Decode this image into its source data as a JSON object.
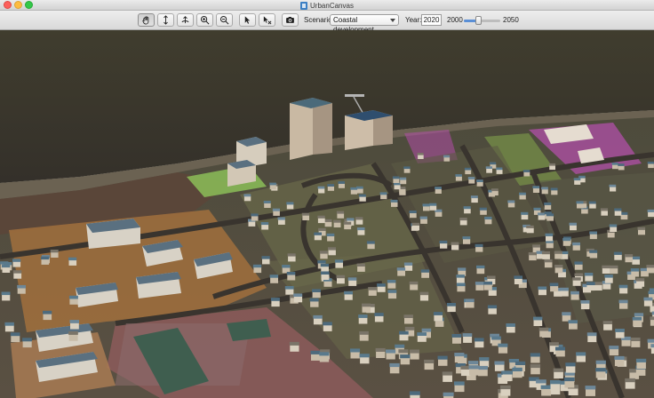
{
  "window": {
    "title": "UrbanCanvas"
  },
  "toolbar": {
    "tools": [
      {
        "name": "pan-tool",
        "icon": "hand-icon",
        "active": true
      },
      {
        "name": "tilt-tool",
        "icon": "vertical-arrows-icon",
        "active": false
      },
      {
        "name": "rotate-tool",
        "icon": "rotate-icon",
        "active": false
      },
      {
        "name": "zoom-in-tool",
        "icon": "zoom-in-icon",
        "active": false
      },
      {
        "name": "zoom-out-tool",
        "icon": "zoom-out-icon",
        "active": false
      },
      {
        "name": "select-tool",
        "icon": "pointer-icon",
        "active": false
      },
      {
        "name": "deselect-tool",
        "icon": "pointer-cross-icon",
        "active": false
      },
      {
        "name": "screenshot-tool",
        "icon": "camera-icon",
        "active": false
      }
    ],
    "scenario_label": "Scenario:",
    "scenario_value": "Coastal development",
    "year_label": "Year:",
    "year_value": "2020",
    "slider_min_label": "2000",
    "slider_max_label": "2050",
    "slider_fraction": 0.4
  },
  "colors": {
    "accent": "#5a8fd6",
    "water": "#3d3a2a",
    "ground": "#5b5142",
    "selection_pink": "#c85ad0"
  }
}
